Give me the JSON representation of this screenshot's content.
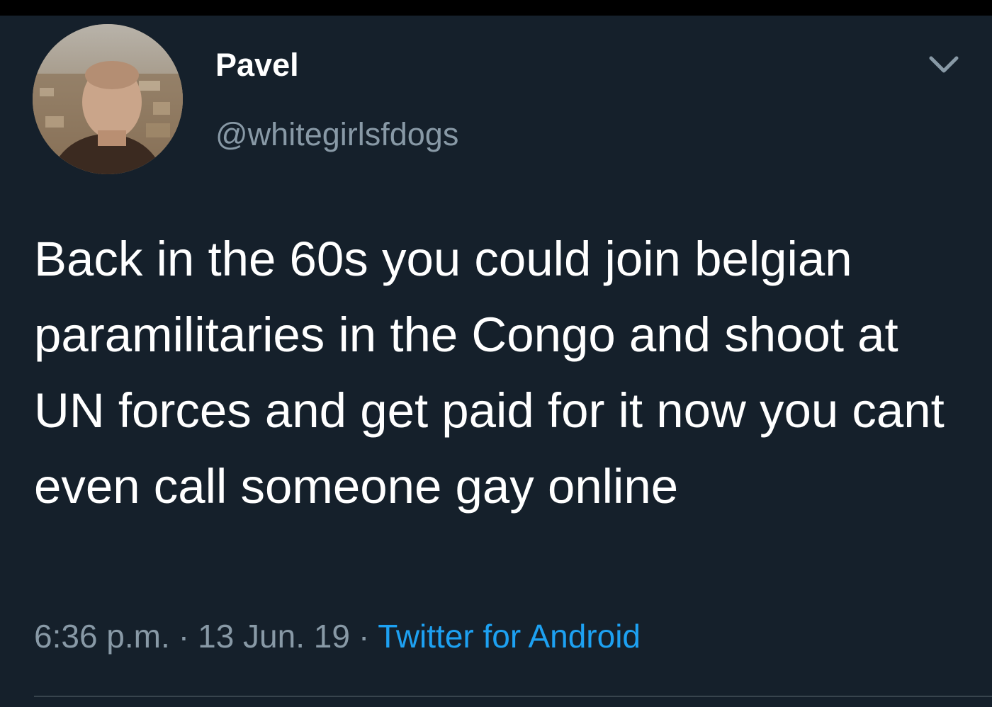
{
  "tweet": {
    "author": {
      "display_name": "Pavel",
      "handle": "@whitegirlsfdogs",
      "avatar_icon": "profile-photo"
    },
    "menu_icon": "chevron-down-icon",
    "text": "Back in the 60s you could join belgian paramilitaries in the Congo and shoot at UN forces and get paid for it now you cant even call someone gay online",
    "time": "6:36 p.m.",
    "date": "13 Jun. 19",
    "separator": "·",
    "source": "Twitter for Android"
  },
  "colors": {
    "background": "#15202b",
    "text_primary": "#ffffff",
    "text_secondary": "#8899a6",
    "link": "#1da1f2",
    "divider": "#38444d"
  }
}
